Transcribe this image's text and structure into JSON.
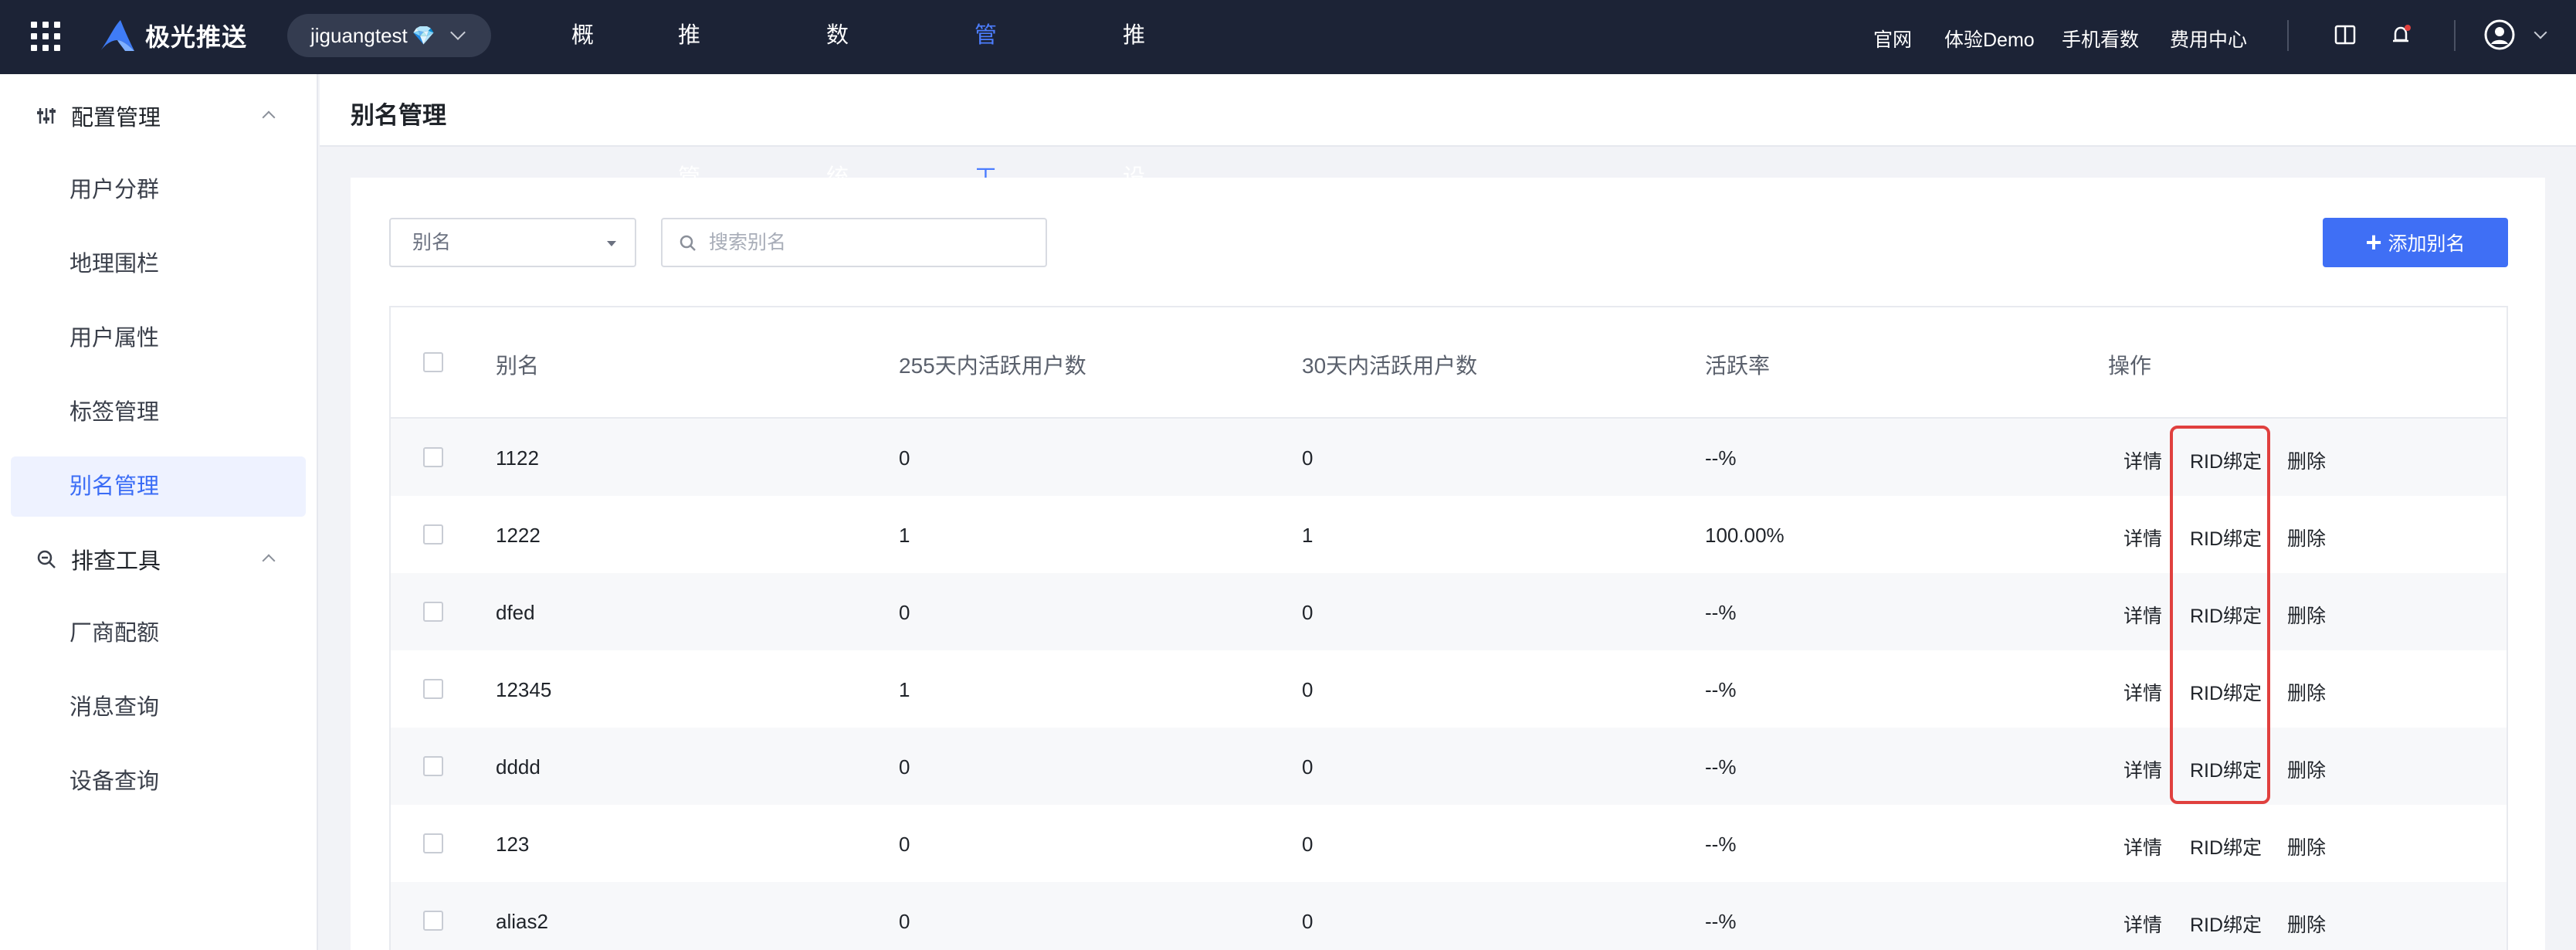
{
  "header": {
    "brand": "极光推送",
    "account": "jiguangtest",
    "account_badge": "💎",
    "nav": [
      {
        "label": "概况",
        "active": false
      },
      {
        "label": "推送管理",
        "active": false
      },
      {
        "label": "数据统计",
        "active": false
      },
      {
        "label": "管理工具",
        "active": true
      },
      {
        "label": "推送设置",
        "active": false
      }
    ],
    "links": [
      "官网",
      "体验Demo",
      "手机看数",
      "费用中心"
    ]
  },
  "sidebar": {
    "groups": [
      {
        "label": "配置管理",
        "icon": "sliders-icon",
        "items": [
          "用户分群",
          "地理围栏",
          "用户属性",
          "标签管理",
          "别名管理"
        ]
      },
      {
        "label": "排查工具",
        "icon": "search-zoom-icon",
        "items": [
          "厂商配额",
          "消息查询",
          "设备查询"
        ]
      }
    ],
    "active_item": "别名管理"
  },
  "page": {
    "title": "别名管理",
    "filter_select": "别名",
    "search_placeholder": "搜索别名",
    "add_button": "添加别名"
  },
  "table": {
    "columns": [
      "别名",
      "255天内活跃用户数",
      "30天内活跃用户数",
      "活跃率",
      "操作"
    ],
    "actions": [
      "详情",
      "RID绑定",
      "删除"
    ],
    "rows": [
      {
        "alias": "1122",
        "active255": "0",
        "active30": "0",
        "rate": "--%"
      },
      {
        "alias": "1222",
        "active255": "1",
        "active30": "1",
        "rate": "100.00%"
      },
      {
        "alias": "dfed",
        "active255": "0",
        "active30": "0",
        "rate": "--%"
      },
      {
        "alias": "12345",
        "active255": "1",
        "active30": "0",
        "rate": "--%"
      },
      {
        "alias": "dddd",
        "active255": "0",
        "active30": "0",
        "rate": "--%"
      },
      {
        "alias": "123",
        "active255": "0",
        "active30": "0",
        "rate": "--%"
      },
      {
        "alias": "alias2",
        "active255": "0",
        "active30": "0",
        "rate": "--%"
      }
    ]
  },
  "colors": {
    "topbar": "#1c2336",
    "accent": "#3f6ff5",
    "highlight": "#e0403e"
  }
}
